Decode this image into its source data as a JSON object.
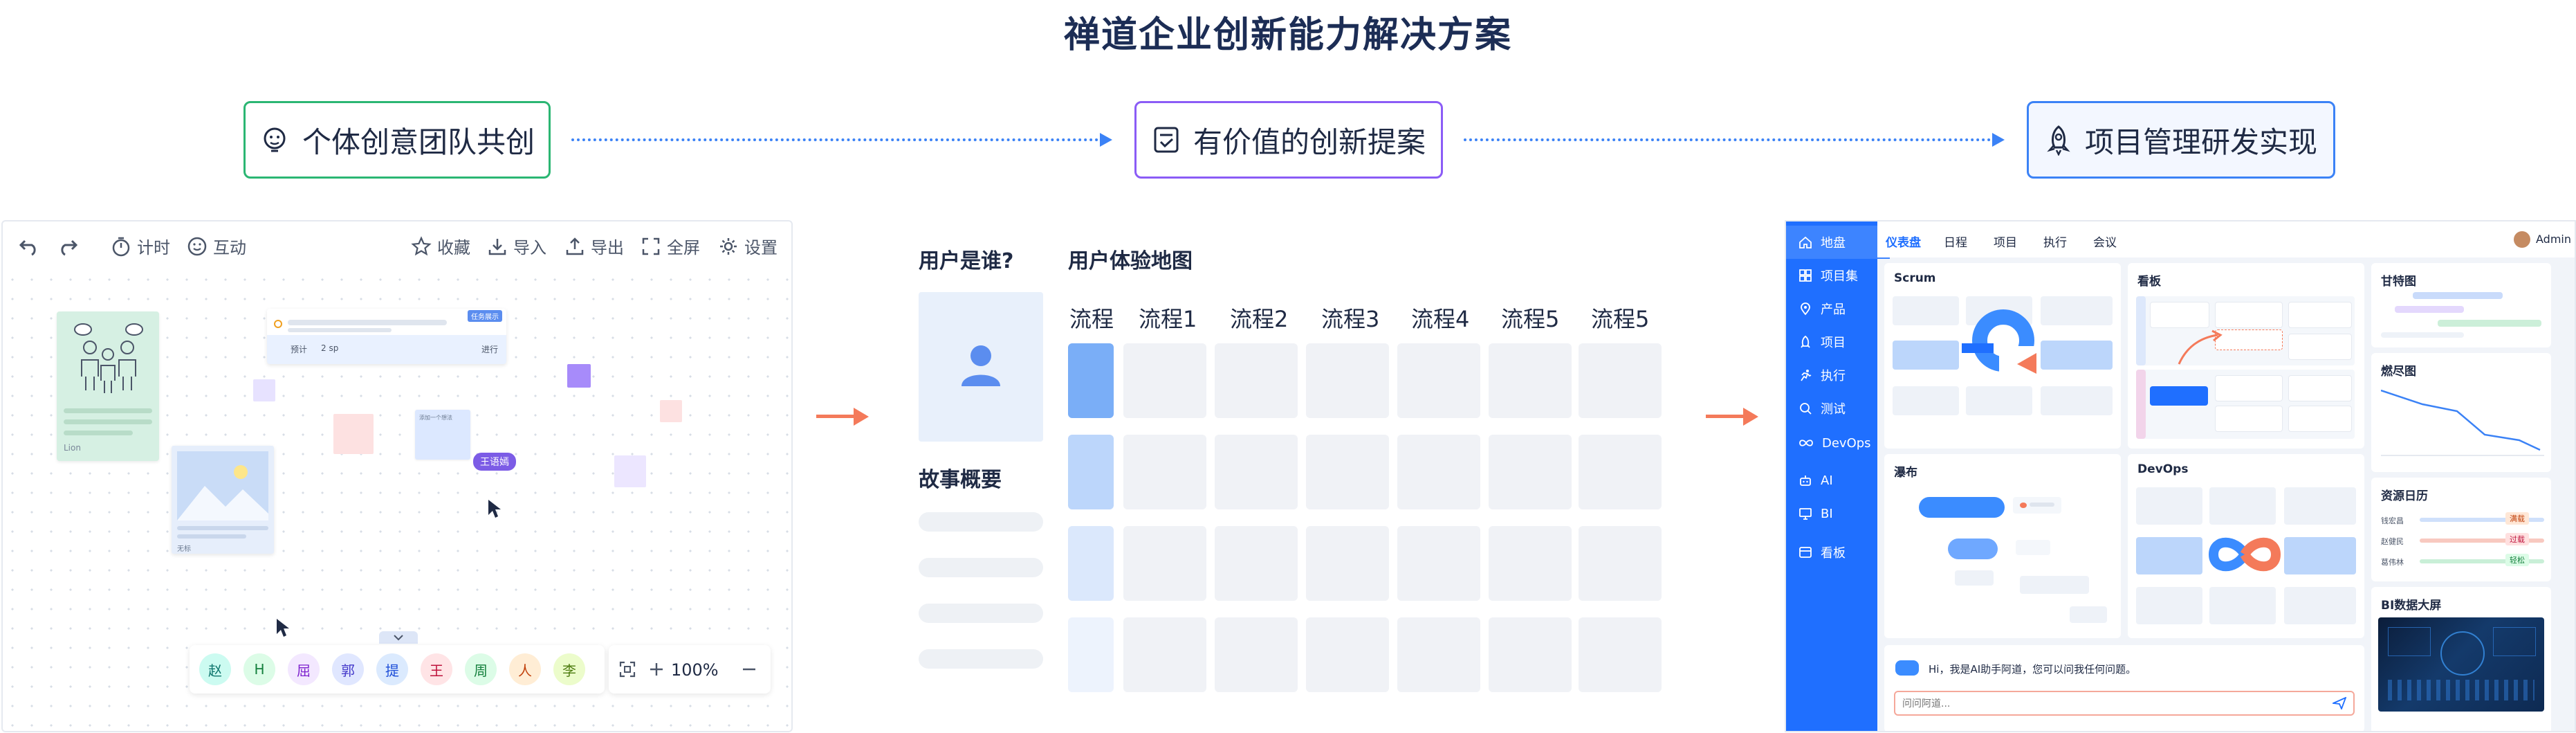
{
  "title": "禅道企业创新能力解决方案",
  "stages": [
    {
      "label": "个体创意团队共创",
      "icon": "lightbulb-face-icon",
      "border": "#2bb673"
    },
    {
      "label": "有价值的创新提案",
      "icon": "clipboard-check-icon",
      "border": "#8b5cf6"
    },
    {
      "label": "项目管理研发实现",
      "icon": "rocket-icon",
      "border": "#3b82f6"
    }
  ],
  "whiteboard": {
    "toolbar": {
      "timer": "计时",
      "interact": "互动",
      "favorite": "收藏",
      "import": "导入",
      "export": "导出",
      "fullscreen": "全屏",
      "settings": "设置"
    },
    "card": {
      "tag": "任务展示",
      "row_label": "预计",
      "row_value": "2 sp",
      "row_status": "进行"
    },
    "note_small_text": "添加一个想法",
    "image_card_label": "Lion",
    "image2_label": "无标",
    "cursor_user": "王语嫣",
    "avatars": [
      "赵",
      "H",
      "屈",
      "郭",
      "提",
      "王",
      "周",
      "人",
      "李"
    ],
    "zoom": "100%"
  },
  "story_map": {
    "user_label": "用户是谁?",
    "summary_label": "故事概要",
    "map_title": "用户体验地图",
    "columns": [
      "流程",
      "流程1",
      "流程2",
      "流程3",
      "流程4",
      "流程5",
      "流程5"
    ]
  },
  "dashboard": {
    "sidebar": [
      {
        "label": "地盘",
        "icon": "home-icon"
      },
      {
        "label": "项目集",
        "icon": "grid-icon"
      },
      {
        "label": "产品",
        "icon": "location-icon"
      },
      {
        "label": "项目",
        "icon": "rocket-icon"
      },
      {
        "label": "执行",
        "icon": "run-icon"
      },
      {
        "label": "测试",
        "icon": "search-icon"
      },
      {
        "label": "DevOps",
        "icon": "infinity-icon"
      },
      {
        "label": "AI",
        "icon": "robot-icon"
      },
      {
        "label": "BI",
        "icon": "monitor-icon"
      },
      {
        "label": "看板",
        "icon": "board-icon"
      }
    ],
    "tabs": [
      "仪表盘",
      "日程",
      "项目",
      "执行",
      "会议"
    ],
    "user": "Admin",
    "cards": {
      "scrum": "Scrum",
      "kanban": "看板",
      "gantt": "甘特图",
      "burndown": "燃尽图",
      "waterfall": "瀑布",
      "devops": "DevOps",
      "resource": "资源日历",
      "bi": "BI数据大屏"
    },
    "resource_rows": [
      {
        "name": "钱宏昌",
        "tag": "满载"
      },
      {
        "name": "赵健民",
        "tag": "过载"
      },
      {
        "name": "葛伟林",
        "tag": "轻松"
      }
    ],
    "ai_greeting": "Hi，我是AI助手阿道，您可以问我任何问题。",
    "ai_placeholder": "问问阿道..."
  }
}
